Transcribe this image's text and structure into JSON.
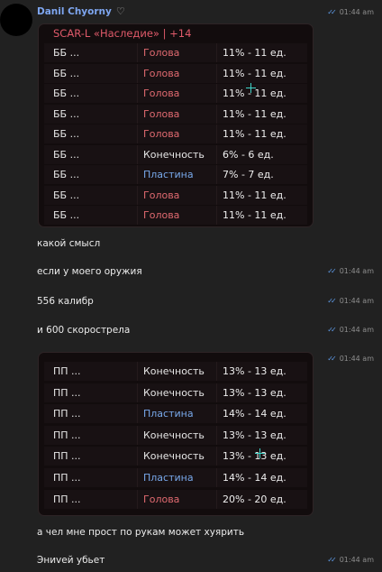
{
  "message1": {
    "sender": "Danil Chyorny",
    "time": "01:44 am",
    "card": {
      "title": "SCAR-L «Наследие» | +14",
      "rows": [
        {
          "c1": "ББ ...",
          "c2": "Голова",
          "c3": "11% - 11 ед.",
          "kind": "head"
        },
        {
          "c1": "ББ ...",
          "c2": "Голова",
          "c3": "11% - 11 ед.",
          "kind": "head"
        },
        {
          "c1": "ББ ...",
          "c2": "Голова",
          "c3": "11% - 11 ед.",
          "kind": "head"
        },
        {
          "c1": "ББ ...",
          "c2": "Голова",
          "c3": "11% - 11 ед.",
          "kind": "head"
        },
        {
          "c1": "ББ ...",
          "c2": "Голова",
          "c3": "11% - 11 ед.",
          "kind": "head"
        },
        {
          "c1": "ББ ...",
          "c2": "Конечность",
          "c3": "6% - 6 ед.",
          "kind": "limb"
        },
        {
          "c1": "ББ ...",
          "c2": "Пластина",
          "c3": "7% - 7 ед.",
          "kind": "plate"
        },
        {
          "c1": "ББ ...",
          "c2": "Голова",
          "c3": "11% - 11 ед.",
          "kind": "head"
        },
        {
          "c1": "ББ ...",
          "c2": "Голова",
          "c3": "11% - 11 ед.",
          "kind": "head"
        }
      ]
    }
  },
  "messages": [
    {
      "text": "какой смысл",
      "time": ""
    },
    {
      "text": "если у моего оружия",
      "time": "01:44 am"
    },
    {
      "text": "556 калибр",
      "time": "01:44 am"
    },
    {
      "text": "и 600 скорострела",
      "time": "01:44 am"
    }
  ],
  "message2": {
    "time": "01:44 am",
    "card": {
      "rows": [
        {
          "c1": "ПП ...",
          "c2": "Конечность",
          "c3": "13% - 13 ед.",
          "kind": "limb"
        },
        {
          "c1": "ПП ...",
          "c2": "Конечность",
          "c3": "13% - 13 ед.",
          "kind": "limb"
        },
        {
          "c1": "ПП ...",
          "c2": "Пластина",
          "c3": "14% - 14 ед.",
          "kind": "plate"
        },
        {
          "c1": "ПП ...",
          "c2": "Конечность",
          "c3": "13% - 13 ед.",
          "kind": "limb"
        },
        {
          "c1": "ПП ...",
          "c2": "Конечность",
          "c3": "13% - 13 ед.",
          "kind": "limb"
        },
        {
          "c1": "ПП ...",
          "c2": "Пластина",
          "c3": "14% - 14 ед.",
          "kind": "plate"
        },
        {
          "c1": "ПП ...",
          "c2": "Голова",
          "c3": "20% - 20 ед.",
          "kind": "head"
        }
      ]
    }
  },
  "messages_after": [
    {
      "text": "а чел мне прост по рукам может хуярить",
      "time": ""
    },
    {
      "text": "Эниvей убьет",
      "time": "01:44 am"
    }
  ],
  "colors": {
    "head": "#e06a70",
    "limb": "#e6e6e6",
    "plate": "#78a8ea",
    "accent": "#7ea6f0"
  }
}
